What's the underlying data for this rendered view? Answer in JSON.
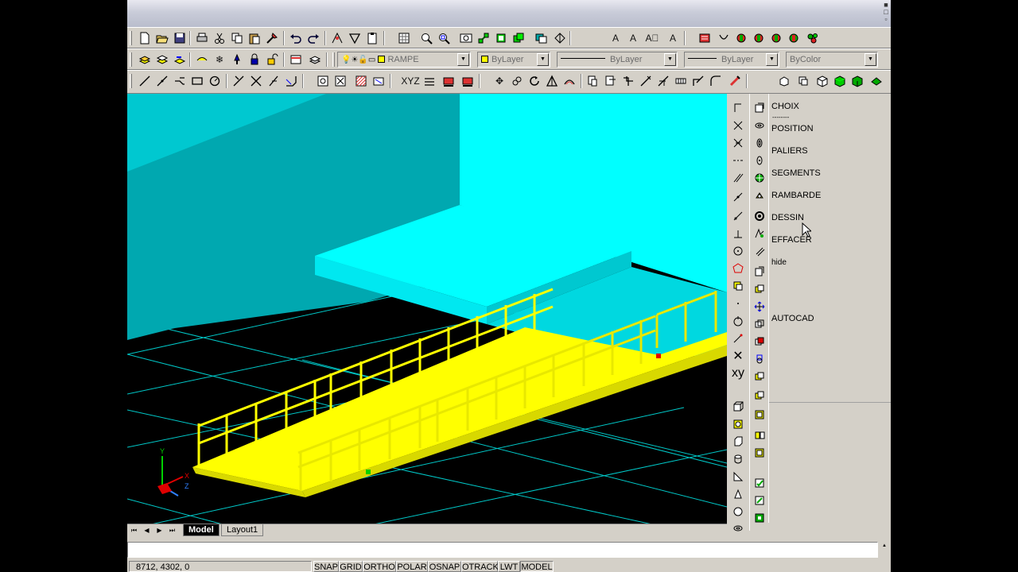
{
  "layer_combo": {
    "name": "RAMPE"
  },
  "color_combo": {
    "value": "ByLayer"
  },
  "linetype_combo": {
    "value": "ByLayer"
  },
  "lineweight_combo": {
    "value": "ByLayer"
  },
  "plotstyle_combo": {
    "value": "ByColor"
  },
  "screen_menu": {
    "items": [
      "CHOIX",
      "POSITION",
      "PALIERS",
      "SEGMENTS",
      "RAMBARDE",
      "DESSIN",
      "EFFACER",
      "hide",
      "AUTOCAD"
    ],
    "separator": "--------"
  },
  "layout_tabs": {
    "model": "Model",
    "layout1": "Layout1"
  },
  "tab_nav": {
    "first": "⏮",
    "prev": "◀",
    "next": "▶",
    "last": "⏭"
  },
  "command_line": {
    "text": ""
  },
  "status_bar": {
    "coordinates": "8712, 4302, 0",
    "toggles": [
      "SNAP",
      "GRID",
      "ORTHO",
      "POLAR",
      "OSNAP",
      "OTRACK",
      "LWT",
      "MODEL"
    ],
    "active": "MODEL"
  },
  "colors": {
    "viewport_bg": "#000000",
    "grid": "#00c8c8",
    "wall_dark": "#00a8b0",
    "wall_light": "#00ffff",
    "ramp": "#ffff00",
    "ui_face": "#d4d0c8"
  },
  "icons": {
    "standard": [
      "new-icon",
      "open-icon",
      "save-icon",
      "print-icon",
      "cut-icon",
      "copy-icon",
      "paste-icon",
      "match-properties-icon",
      "undo-icon",
      "redo-icon",
      "tracking-icon",
      "filter-icon",
      "clipboard-icon",
      "named-views-icon",
      "zoom-realtime-icon",
      "zoom-window-icon",
      "zoom-previous-icon",
      "3d-orbit-icon",
      "render-icon",
      "shade-icon",
      "dbconnect-icon",
      "design-center-icon",
      "text-style-icon",
      "text-icon",
      "multiline-text-icon",
      "spell-icon",
      "dimension-icon",
      "toolbar-icon",
      "cylinder-red-icon",
      "cylinder-green-icon",
      "sphere-icon",
      "globe-icon",
      "cluster-icon"
    ],
    "layers": [
      "layer-manager-icon",
      "layer-states-icon",
      "layer-previous-icon",
      "on-off-icon",
      "freeze-icon",
      "lock-icon",
      "layer-sets-icon",
      "properties-icon",
      "layer-match-icon"
    ],
    "draw_modify": [
      "line-icon",
      "construction-line-icon",
      "polyline-icon",
      "rectangle-icon",
      "circle-icon",
      "trim-icon",
      "extend-icon",
      "break-icon",
      "fillet-icon",
      "block-icon",
      "insert-icon",
      "hatch-icon",
      "region-icon",
      "table-icon",
      "array-icon",
      "text-icon",
      "move-icon",
      "copy-object-icon",
      "rotate-icon",
      "mirror-icon",
      "offset-icon",
      "scale-icon",
      "stretch-icon",
      "chamfer-icon",
      "explode-icon",
      "erase-icon",
      "sweep-icon",
      "join-icon",
      "box-icon",
      "wedge-icon",
      "cone-icon",
      "sphere-solid-icon",
      "torus-icon"
    ]
  }
}
